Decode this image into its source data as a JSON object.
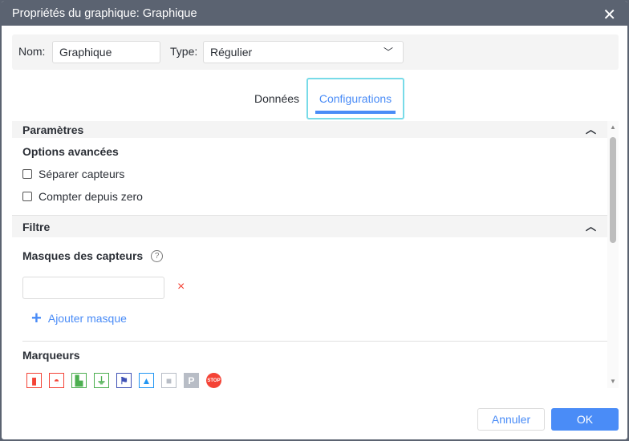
{
  "title": "Propriétés du graphique: Graphique",
  "name_label": "Nom:",
  "name_value": "Graphique",
  "type_label": "Type:",
  "type_value": "Régulier",
  "tabs": [
    {
      "label": "Données"
    },
    {
      "label": "Configurations"
    }
  ],
  "sections": {
    "parametres": {
      "title": "Paramètres",
      "subtitle": "Options avancées",
      "options": [
        "Séparer capteurs",
        "Compter depuis zero"
      ]
    },
    "filtre": {
      "title": "Filtre",
      "masks_label": "Masques des capteurs",
      "mask_value": "",
      "add_mask": "Ajouter masque",
      "markers_label": "Marqueurs"
    }
  },
  "markers": [
    {
      "icon": "fuel-can-icon",
      "color": "#f44336"
    },
    {
      "icon": "gauge-icon",
      "color": "#f44336"
    },
    {
      "icon": "fuel-station-icon",
      "color": "#4caf50"
    },
    {
      "icon": "plug-icon",
      "color": "#4caf50"
    },
    {
      "icon": "flag-icon",
      "color": "#3f51b5"
    },
    {
      "icon": "image-icon",
      "color": "#2196f3"
    },
    {
      "icon": "video-icon",
      "color": "#b8bdc6"
    },
    {
      "icon": "parking-icon",
      "color": "#b8bdc6"
    },
    {
      "icon": "stop-icon",
      "color": "#f44336",
      "text": "STOP"
    }
  ],
  "buttons": {
    "cancel": "Annuler",
    "ok": "OK"
  }
}
